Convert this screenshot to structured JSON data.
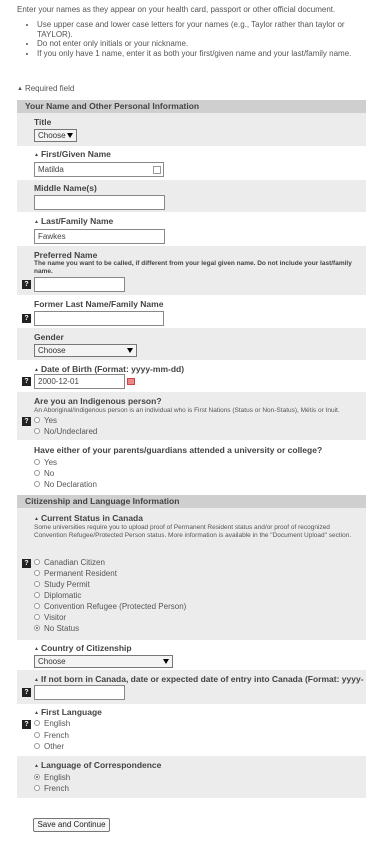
{
  "intro": {
    "text": "Enter your names as they appear on your health card, passport or other official document.",
    "bullets": [
      "Use upper case and lower case letters for your names (e.g., Taylor rather than taylor or TAYLOR).",
      "Do not enter only initials or your nickname.",
      "If you only have 1 name, enter it as both your first/given name and your last/family name."
    ]
  },
  "required_note": "Required field",
  "section1": {
    "title": "Your Name and Other Personal Information",
    "title_field": {
      "label": "Title",
      "value": "Choose"
    },
    "first_name": {
      "label": "First/Given Name",
      "value": "Matilda"
    },
    "middle_name": {
      "label": "Middle Name(s)",
      "value": ""
    },
    "last_name": {
      "label": "Last/Family Name",
      "value": "Fawkes"
    },
    "preferred_name": {
      "label": "Preferred Name",
      "hint": "The name you want to be called, if different from your legal given name. Do not include your last/family name.",
      "value": ""
    },
    "former_last_name": {
      "label": "Former Last Name/Family Name",
      "value": ""
    },
    "gender": {
      "label": "Gender",
      "value": "Choose"
    },
    "dob": {
      "label": "Date of Birth (Format: yyyy-mm-dd)",
      "value": "2000-12-01"
    },
    "indigenous": {
      "label": "Are you an Indigenous person?",
      "hint": "An Aboriginal/Indigenous person is an individual who is First Nations (Status or Non-Status), Métis or Inuit.",
      "options": [
        "Yes",
        "No/Undeclared"
      ]
    },
    "parents": {
      "label": "Have either of your parents/guardians attended a university or college?",
      "options": [
        "Yes",
        "No",
        "No Declaration"
      ]
    }
  },
  "section2": {
    "title": "Citizenship and Language Information",
    "status": {
      "label": "Current Status in Canada",
      "hint": "Some universities require you to upload proof of Permanent Resident status and/or proof of recognized Convention Refugee/Protected Person status. More information is available in the \"Document Upload\" section.",
      "options": [
        "Canadian Citizen",
        "Permanent Resident",
        "Study Permit",
        "Diplomatic",
        "Convention Refugee (Protected Person)",
        "Visitor",
        "No Status"
      ],
      "selected": 6
    },
    "country": {
      "label": "Country of Citizenship",
      "value": "Choose"
    },
    "entry_date": {
      "label": "If not born in Canada, date or expected date of entry into Canada (Format: yyyy-mm)",
      "value": ""
    },
    "first_language": {
      "label": "First Language",
      "options": [
        "English",
        "French",
        "Other"
      ]
    },
    "correspondence": {
      "label": "Language of Correspondence",
      "options": [
        "English",
        "French"
      ],
      "selected": 0
    }
  },
  "submit_label": "Save and Continue",
  "help_label": "?"
}
